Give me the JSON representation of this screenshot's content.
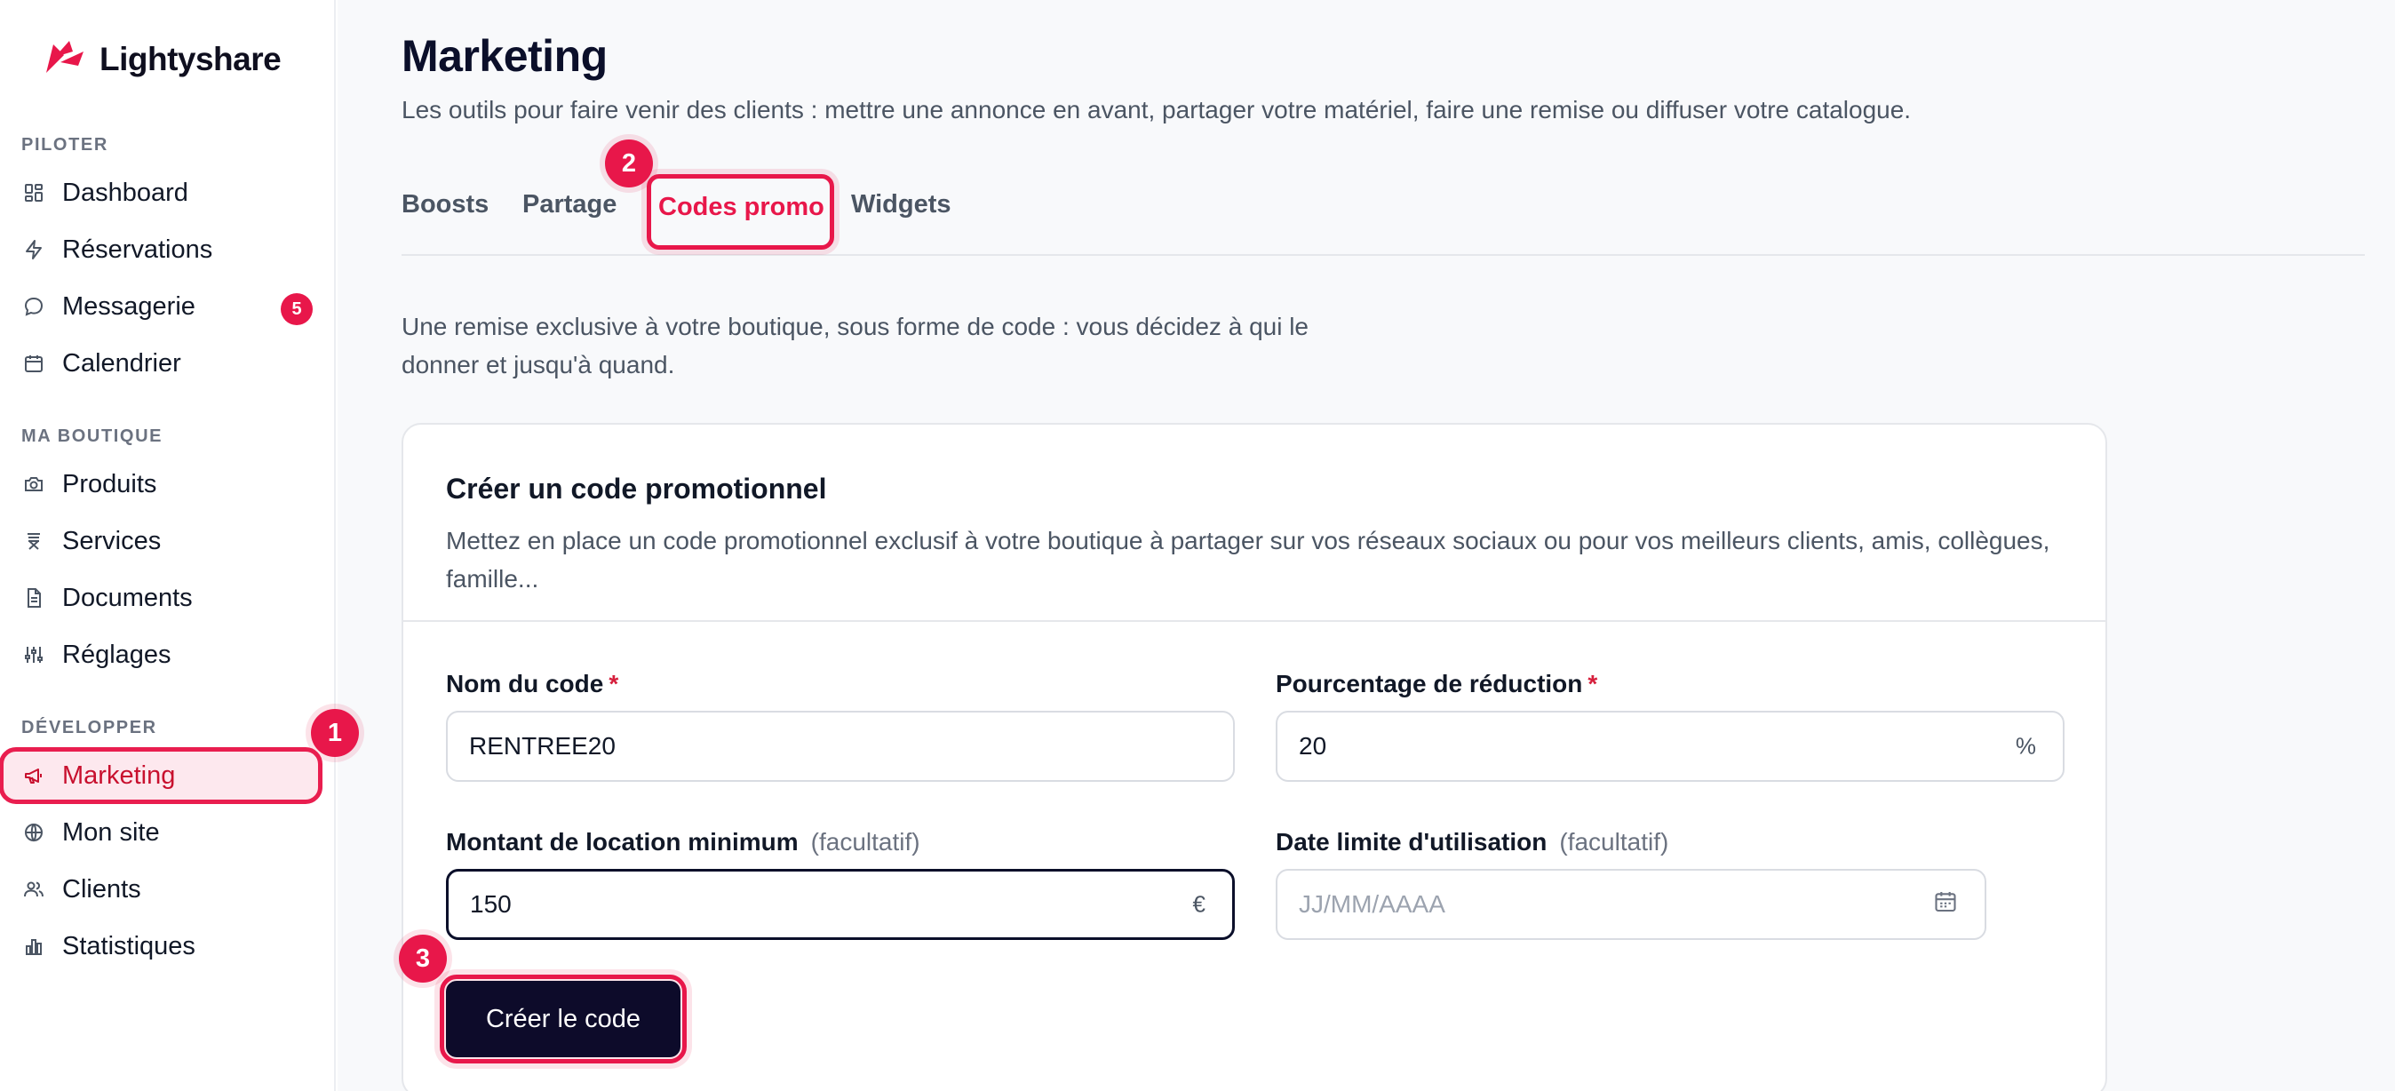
{
  "brand": {
    "name": "Lightyshare",
    "accent": "#e8174a",
    "dark": "#0d0b2a"
  },
  "sidebar": {
    "sections": [
      {
        "label": "PILOTER"
      },
      {
        "label": "MA BOUTIQUE"
      },
      {
        "label": "DÉVELOPPER"
      }
    ],
    "items": [
      {
        "label": "Dashboard",
        "icon": "dashboard-icon"
      },
      {
        "label": "Réservations",
        "icon": "bolt-icon"
      },
      {
        "label": "Messagerie",
        "icon": "chat-bubble-icon",
        "badge": "5"
      },
      {
        "label": "Calendrier",
        "icon": "calendar-icon"
      },
      {
        "label": "Produits",
        "icon": "camera-icon"
      },
      {
        "label": "Services",
        "icon": "director-chair-icon"
      },
      {
        "label": "Documents",
        "icon": "document-icon"
      },
      {
        "label": "Réglages",
        "icon": "sliders-icon"
      },
      {
        "label": "Marketing",
        "icon": "megaphone-icon",
        "active": true
      },
      {
        "label": "Mon site",
        "icon": "globe-icon"
      },
      {
        "label": "Clients",
        "icon": "users-icon"
      },
      {
        "label": "Statistiques",
        "icon": "bar-chart-icon"
      }
    ]
  },
  "steps": [
    "1",
    "2",
    "3"
  ],
  "main": {
    "title": "Marketing",
    "subtitle": "Les outils pour faire venir des clients : mettre une annonce en avant, partager votre matériel, faire une remise ou diffuser votre catalogue.",
    "tabs": [
      {
        "label": "Boosts"
      },
      {
        "label": "Partage"
      },
      {
        "label": "Codes promo",
        "active": true
      },
      {
        "label": "Widgets"
      }
    ],
    "intro": "Une remise exclusive à votre boutique, sous forme de code : vous décidez à qui le donner et jusqu'à quand.",
    "card": {
      "title": "Créer un code promotionnel",
      "description": "Mettez en place un code promotionnel exclusif à votre boutique à partager sur vos réseaux sociaux ou pour vos meilleurs clients, amis, collègues, famille...",
      "fields": {
        "code_name": {
          "label": "Nom du code",
          "required": "*",
          "value": "RENTREE20"
        },
        "discount": {
          "label": "Pourcentage de réduction",
          "required": "*",
          "value": "20",
          "suffix": "%"
        },
        "min_amount": {
          "label": "Montant de location minimum",
          "optional": "(facultatif)",
          "value": "150",
          "suffix": "€"
        },
        "deadline": {
          "label": "Date limite d'utilisation",
          "optional": "(facultatif)",
          "placeholder": "JJ/MM/AAAA"
        }
      },
      "submit_label": "Créer le code"
    }
  }
}
